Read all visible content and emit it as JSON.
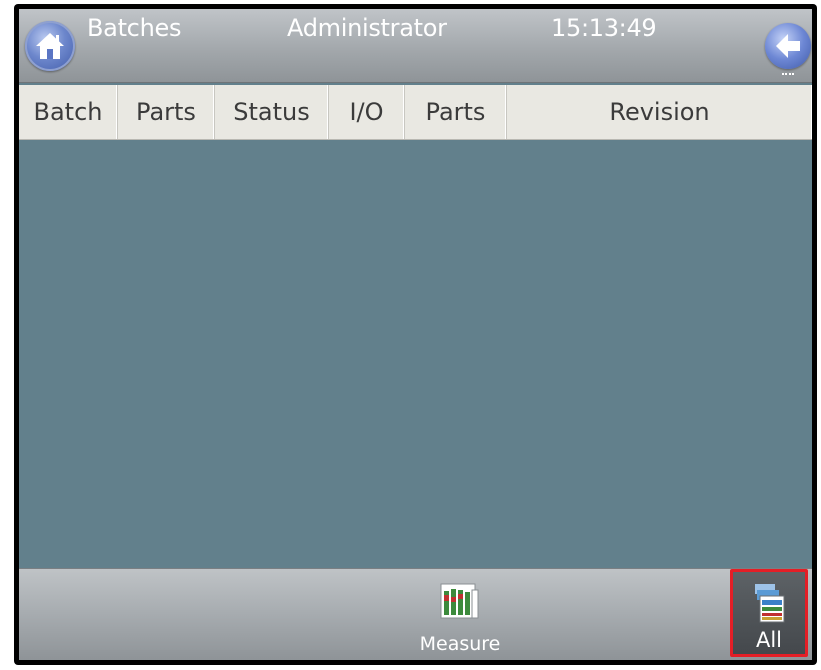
{
  "header": {
    "title": "Batches",
    "user": "Administrator",
    "time": "15:13:49"
  },
  "columns": [
    {
      "label": "Batch"
    },
    {
      "label": "Parts"
    },
    {
      "label": "Status"
    },
    {
      "label": "I/O"
    },
    {
      "label": "Parts"
    },
    {
      "label": "Revision"
    }
  ],
  "toolbar": {
    "measure_label": "Measure",
    "all_label": "All"
  },
  "colors": {
    "list_background": "#62808c",
    "header_background": "#a3a8ac",
    "selected_outline": "#e41e26",
    "accent_blue": "#5a75c4"
  },
  "icons": {
    "home": "home-icon",
    "back": "back-arrow-icon",
    "measure": "measure-icon",
    "all": "batches-all-icon"
  }
}
